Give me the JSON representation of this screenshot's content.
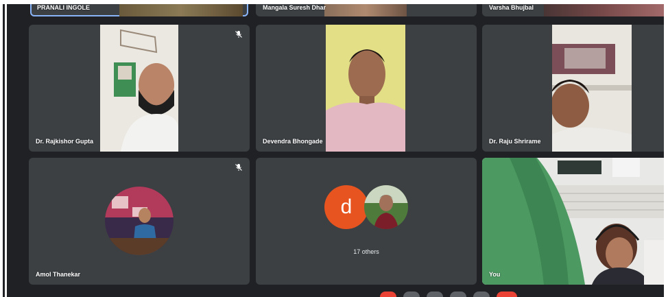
{
  "top_row": [
    {
      "name": "PRANALI INGOLE",
      "active": true
    },
    {
      "name": "Mangala Suresh Dhar"
    },
    {
      "name": "Varsha Bhujbal"
    }
  ],
  "tiles": [
    {
      "name": "Dr. Rajkishor Gupta",
      "muted": true
    },
    {
      "name": "Devendra Bhongade",
      "muted": false
    },
    {
      "name": "Dr. Raju Shrirame",
      "muted": false
    },
    {
      "name": "Amol Thanekar",
      "muted": true
    },
    {
      "avatar_letter": "d",
      "others_label": "17 others"
    },
    {
      "name": "You"
    }
  ],
  "icons": {
    "muted": "mic-off-icon"
  },
  "colors": {
    "background": "#202124",
    "tile": "#3c4043",
    "active_border": "#8ab4f8",
    "avatar_letter_bg": "#e8541f",
    "end_call": "#ea4335"
  }
}
